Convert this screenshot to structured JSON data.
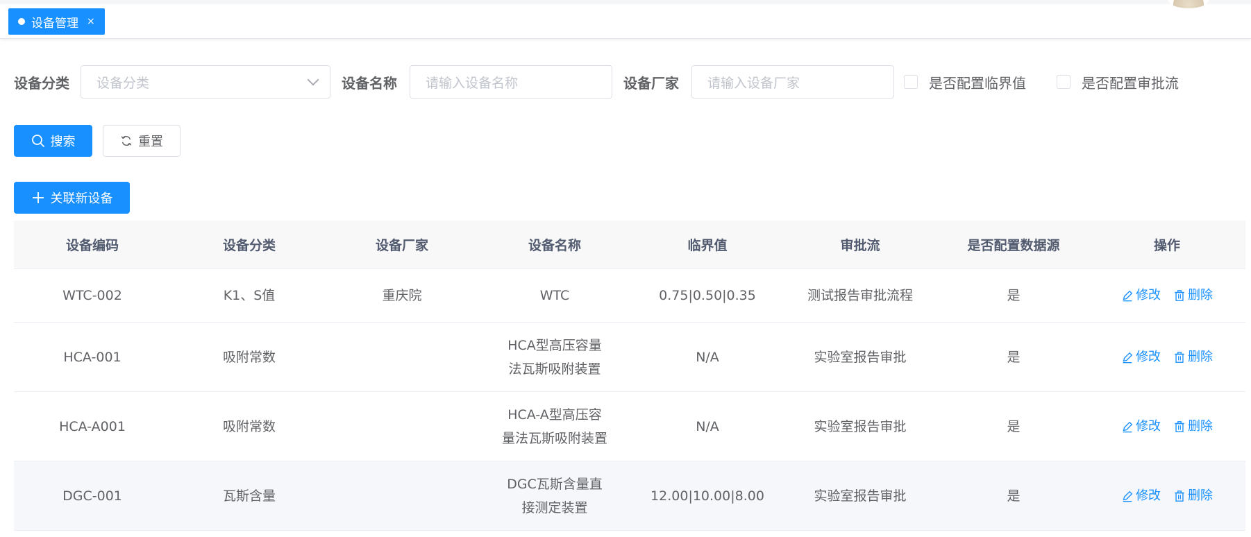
{
  "tabs": [
    {
      "label": "设备管理",
      "close": "×"
    }
  ],
  "filters": {
    "category_label": "设备分类",
    "category_placeholder": "设备分类",
    "name_label": "设备名称",
    "name_placeholder": "请输入设备名称",
    "vendor_label": "设备厂家",
    "vendor_placeholder": "请输入设备厂家",
    "threshold_checkbox": "是否配置临界值",
    "approval_checkbox": "是否配置审批流"
  },
  "buttons": {
    "search": "搜索",
    "reset": "重置",
    "add": "关联新设备"
  },
  "table": {
    "headers": [
      "设备编码",
      "设备分类",
      "设备厂家",
      "设备名称",
      "临界值",
      "审批流",
      "是否配置数据源",
      "操作"
    ],
    "edit_label": "修改",
    "delete_label": "删除",
    "rows": [
      {
        "code": "WTC-002",
        "category": "K1、S值",
        "vendor": "重庆院",
        "name": "WTC",
        "threshold": "0.75|0.50|0.35",
        "approval": "测试报告审批流程",
        "datasource": "是"
      },
      {
        "code": "HCA-001",
        "category": "吸附常数",
        "vendor": "",
        "name": "HCA型高压容量法瓦斯吸附装置",
        "threshold": "N/A",
        "approval": "实验室报告审批",
        "datasource": "是"
      },
      {
        "code": "HCA-A001",
        "category": "吸附常数",
        "vendor": "",
        "name": "HCA-A型高压容量法瓦斯吸附装置",
        "threshold": "N/A",
        "approval": "实验室报告审批",
        "datasource": "是"
      },
      {
        "code": "DGC-001",
        "category": "瓦斯含量",
        "vendor": "",
        "name": "DGC瓦斯含量直接测定装置",
        "threshold": "12.00|10.00|8.00",
        "approval": "实验室报告审批",
        "datasource": "是"
      }
    ]
  },
  "colors": {
    "primary": "#1890ff",
    "header_bg": "#f8f8f9"
  }
}
